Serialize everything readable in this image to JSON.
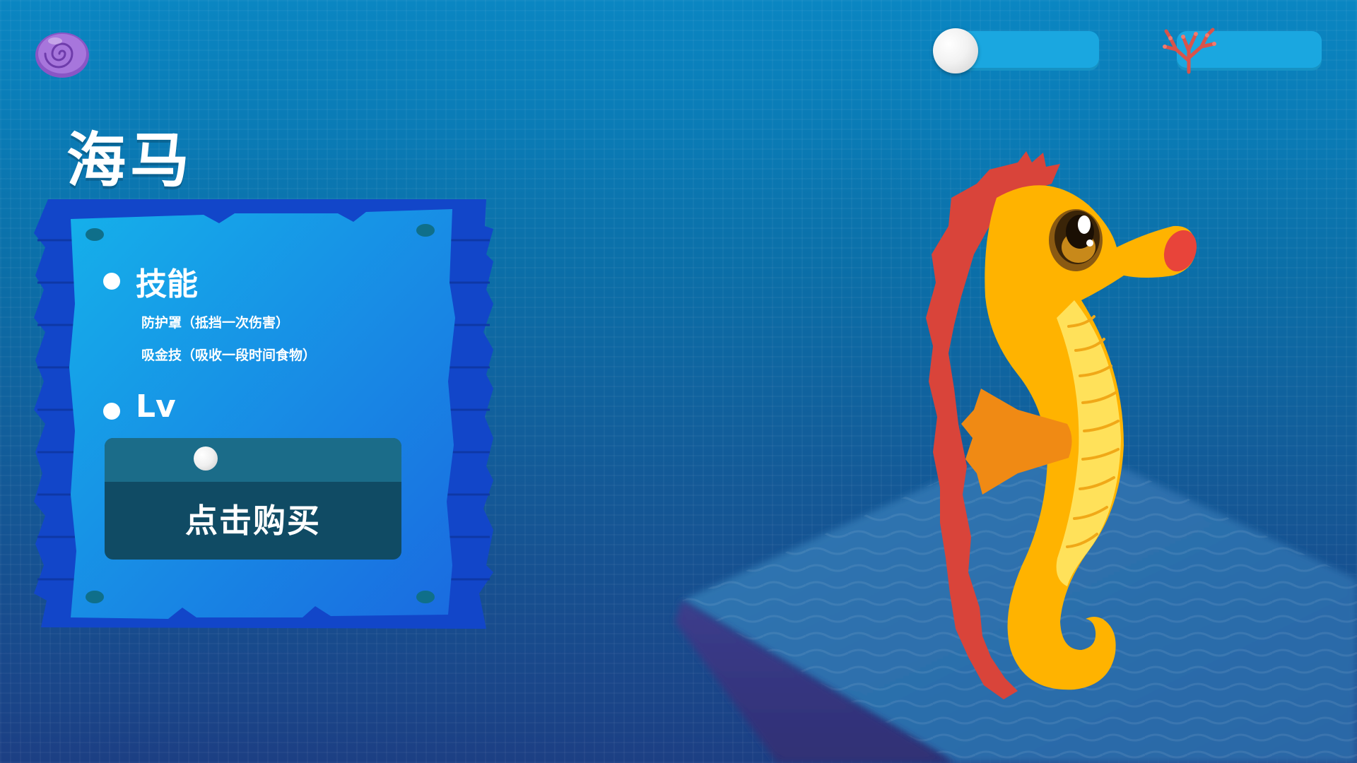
{
  "hud": {
    "shell_icon": "spiral-shell-icon",
    "pearl_icon": "pearl-icon",
    "pearl_count": "",
    "coral_icon": "coral-icon",
    "coral_count": ""
  },
  "title": "海马",
  "board": {
    "skills_heading": "技能",
    "skills": [
      "防护罩（抵挡一次伤害）",
      "吸金技（吸收一段时间食物）"
    ],
    "lv_heading": "Lv",
    "lv_value": "",
    "price_icon": "pearl-icon",
    "price_value": "",
    "buy_label": "点击购买"
  },
  "character": {
    "name_icon": "seahorse-character",
    "colors": {
      "body": "#ffb300",
      "fin_crest": "#d9443a",
      "belly": "#ffe15a",
      "side_fin": "#f08a14",
      "snout_ring": "#e8443a"
    }
  },
  "colors": {
    "bg_top": "#0a86c2",
    "bg_bottom": "#1c3f84",
    "hud_bar": "#1aa7e0",
    "board_dark": "#1246c9",
    "board_light": "#1fa0e8",
    "buy_dark": "#104b64",
    "buy_strip": "#1b6c89"
  }
}
